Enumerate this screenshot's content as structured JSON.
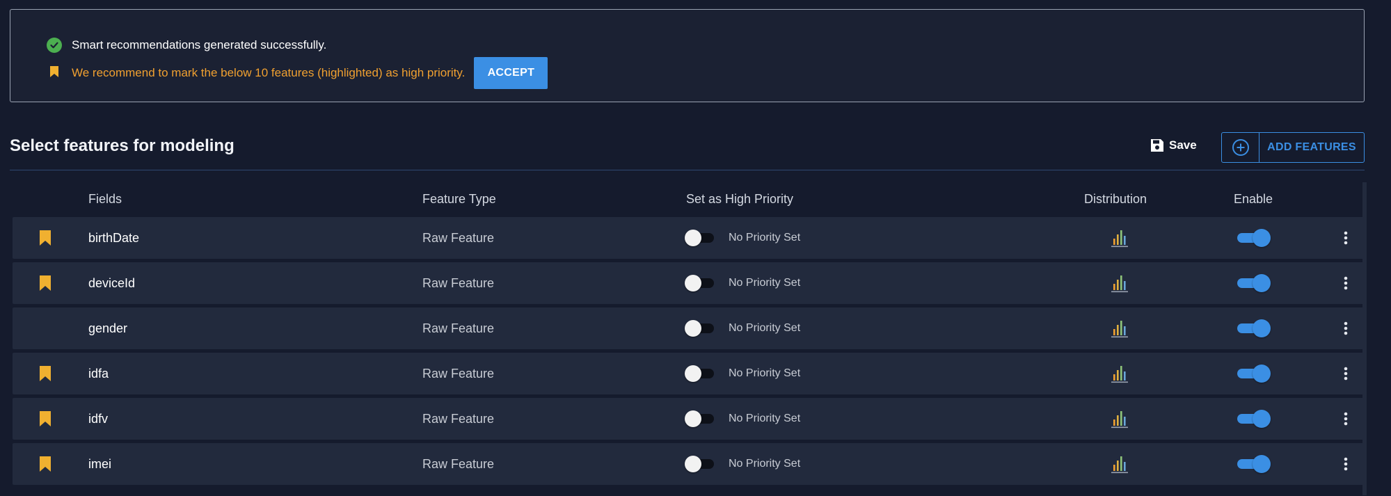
{
  "notice": {
    "success_text": "Smart recommendations generated successfully.",
    "recommend_text": "We recommend to mark the below 10 features (highlighted) as high priority.",
    "accept_label": "ACCEPT"
  },
  "header": {
    "title": "Select features for modeling",
    "save_label": "Save",
    "add_label": "ADD FEATURES"
  },
  "table": {
    "columns": [
      "Fields",
      "Feature Type",
      "Set as High Priority",
      "Distribution",
      "Enable"
    ],
    "rows": [
      {
        "field": "birthDate",
        "type": "Raw Feature",
        "priority": "No Priority Set",
        "recommended": true,
        "enabled": true
      },
      {
        "field": "deviceId",
        "type": "Raw Feature",
        "priority": "No Priority Set",
        "recommended": true,
        "enabled": true
      },
      {
        "field": "gender",
        "type": "Raw Feature",
        "priority": "No Priority Set",
        "recommended": false,
        "enabled": true
      },
      {
        "field": "idfa",
        "type": "Raw Feature",
        "priority": "No Priority Set",
        "recommended": true,
        "enabled": true
      },
      {
        "field": "idfv",
        "type": "Raw Feature",
        "priority": "No Priority Set",
        "recommended": true,
        "enabled": true
      },
      {
        "field": "imei",
        "type": "Raw Feature",
        "priority": "No Priority Set",
        "recommended": true,
        "enabled": true
      }
    ]
  },
  "colors": {
    "accent": "#3b8fe4",
    "bookmark": "#f0b030",
    "success": "#4caf50",
    "warning_text": "#f0a030"
  },
  "icons": {
    "success": "check-circle-icon",
    "recommend": "bookmark-icon",
    "save": "floppy-disk-icon",
    "add": "plus-circle-icon",
    "distribution": "bar-chart-icon",
    "menu": "more-vertical-icon"
  }
}
